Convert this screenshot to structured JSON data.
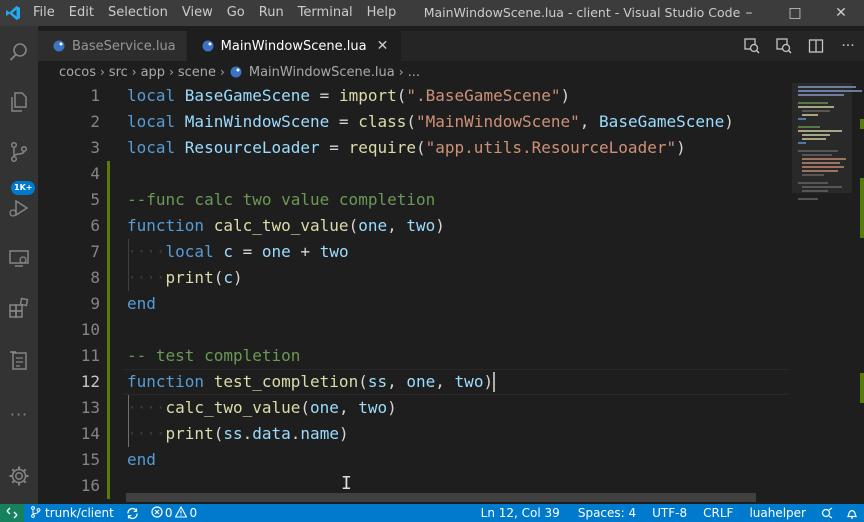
{
  "titlebar": {
    "menu": [
      "File",
      "Edit",
      "Selection",
      "View",
      "Go",
      "Run",
      "Terminal",
      "Help"
    ],
    "window_title": "MainWindowScene.lua - client - Visual Studio Code",
    "minimize": "–",
    "maximize": "□",
    "close": "✕"
  },
  "activity": {
    "badge": "1K+",
    "more": "···"
  },
  "tabs": [
    {
      "label": "BaseService.lua",
      "active": false
    },
    {
      "label": "MainWindowScene.lua",
      "active": true,
      "close": "✕"
    }
  ],
  "breadcrumb": [
    "cocos",
    "src",
    "app",
    "scene",
    "MainWindowScene.lua",
    "..."
  ],
  "editor": {
    "lines": [
      {
        "n": "1",
        "tokens": [
          {
            "t": "local ",
            "c": "kw"
          },
          {
            "t": "BaseGameScene",
            "c": "ident"
          },
          {
            "t": " = ",
            "c": "plain"
          },
          {
            "t": "import",
            "c": "fn"
          },
          {
            "t": "(",
            "c": "plain"
          },
          {
            "t": "\".BaseGameScene\"",
            "c": "str"
          },
          {
            "t": ")",
            "c": "plain"
          }
        ]
      },
      {
        "n": "2",
        "tokens": [
          {
            "t": "local ",
            "c": "kw"
          },
          {
            "t": "MainWindowScene",
            "c": "ident"
          },
          {
            "t": " = ",
            "c": "plain"
          },
          {
            "t": "class",
            "c": "fn"
          },
          {
            "t": "(",
            "c": "plain"
          },
          {
            "t": "\"MainWindowScene\"",
            "c": "str"
          },
          {
            "t": ", ",
            "c": "plain"
          },
          {
            "t": "BaseGameScene",
            "c": "ident"
          },
          {
            "t": ")",
            "c": "plain"
          }
        ]
      },
      {
        "n": "3",
        "tokens": [
          {
            "t": "local ",
            "c": "kw"
          },
          {
            "t": "ResourceLoader",
            "c": "ident"
          },
          {
            "t": " = ",
            "c": "plain"
          },
          {
            "t": "require",
            "c": "fn"
          },
          {
            "t": "(",
            "c": "plain"
          },
          {
            "t": "\"app.utils.ResourceLoader\"",
            "c": "str"
          },
          {
            "t": ")",
            "c": "plain"
          }
        ]
      },
      {
        "n": "4",
        "tokens": []
      },
      {
        "n": "5",
        "tokens": [
          {
            "t": "--func calc two value completion",
            "c": "cmt"
          }
        ]
      },
      {
        "n": "6",
        "tokens": [
          {
            "t": "function ",
            "c": "kw"
          },
          {
            "t": "calc_two_value",
            "c": "fn"
          },
          {
            "t": "(",
            "c": "plain"
          },
          {
            "t": "one",
            "c": "ident"
          },
          {
            "t": ", ",
            "c": "plain"
          },
          {
            "t": "two",
            "c": "ident"
          },
          {
            "t": ")",
            "c": "plain"
          }
        ]
      },
      {
        "n": "7",
        "tokens": [
          {
            "t": "····",
            "c": "ws"
          },
          {
            "t": "local ",
            "c": "kw"
          },
          {
            "t": "c",
            "c": "ident"
          },
          {
            "t": " = ",
            "c": "plain"
          },
          {
            "t": "one",
            "c": "ident"
          },
          {
            "t": " + ",
            "c": "plain"
          },
          {
            "t": "two",
            "c": "ident"
          }
        ]
      },
      {
        "n": "8",
        "tokens": [
          {
            "t": "····",
            "c": "ws"
          },
          {
            "t": "print",
            "c": "fn"
          },
          {
            "t": "(",
            "c": "plain"
          },
          {
            "t": "c",
            "c": "ident"
          },
          {
            "t": ")",
            "c": "plain"
          }
        ]
      },
      {
        "n": "9",
        "tokens": [
          {
            "t": "end",
            "c": "kw"
          }
        ]
      },
      {
        "n": "10",
        "tokens": []
      },
      {
        "n": "11",
        "tokens": [
          {
            "t": "-- test completion",
            "c": "cmt"
          }
        ]
      },
      {
        "n": "12",
        "tokens": [
          {
            "t": "function ",
            "c": "kw"
          },
          {
            "t": "test_completion",
            "c": "fn"
          },
          {
            "t": "(",
            "c": "plain"
          },
          {
            "t": "ss",
            "c": "ident"
          },
          {
            "t": ", ",
            "c": "plain"
          },
          {
            "t": "one",
            "c": "ident"
          },
          {
            "t": ", ",
            "c": "plain"
          },
          {
            "t": "two",
            "c": "ident"
          },
          {
            "t": ")",
            "c": "plain"
          }
        ]
      },
      {
        "n": "13",
        "tokens": [
          {
            "t": "····",
            "c": "ws"
          },
          {
            "t": "calc_two_value",
            "c": "fn"
          },
          {
            "t": "(",
            "c": "plain"
          },
          {
            "t": "one",
            "c": "ident"
          },
          {
            "t": ", ",
            "c": "plain"
          },
          {
            "t": "two",
            "c": "ident"
          },
          {
            "t": ")",
            "c": "plain"
          }
        ]
      },
      {
        "n": "14",
        "tokens": [
          {
            "t": "····",
            "c": "ws"
          },
          {
            "t": "print",
            "c": "fn"
          },
          {
            "t": "(",
            "c": "plain"
          },
          {
            "t": "ss",
            "c": "ident"
          },
          {
            "t": ".",
            "c": "plain"
          },
          {
            "t": "data",
            "c": "ident"
          },
          {
            "t": ".",
            "c": "plain"
          },
          {
            "t": "name",
            "c": "ident"
          },
          {
            "t": ")",
            "c": "plain"
          }
        ]
      },
      {
        "n": "15",
        "tokens": [
          {
            "t": "end",
            "c": "kw"
          }
        ]
      },
      {
        "n": "16",
        "tokens": []
      }
    ],
    "current_line": "12"
  },
  "statusbar": {
    "branch": "trunk/client",
    "errors": "0",
    "warnings": "0",
    "position": "Ln 12, Col 39",
    "spaces": "Spaces: 4",
    "encoding": "UTF-8",
    "eol": "CRLF",
    "language": "luahelper"
  },
  "colors": {
    "accent": "#007acc",
    "keyword": "#569cd6",
    "function": "#dcdcaa",
    "string": "#ce9178",
    "comment": "#6a9955",
    "variable": "#9cdcfe"
  }
}
